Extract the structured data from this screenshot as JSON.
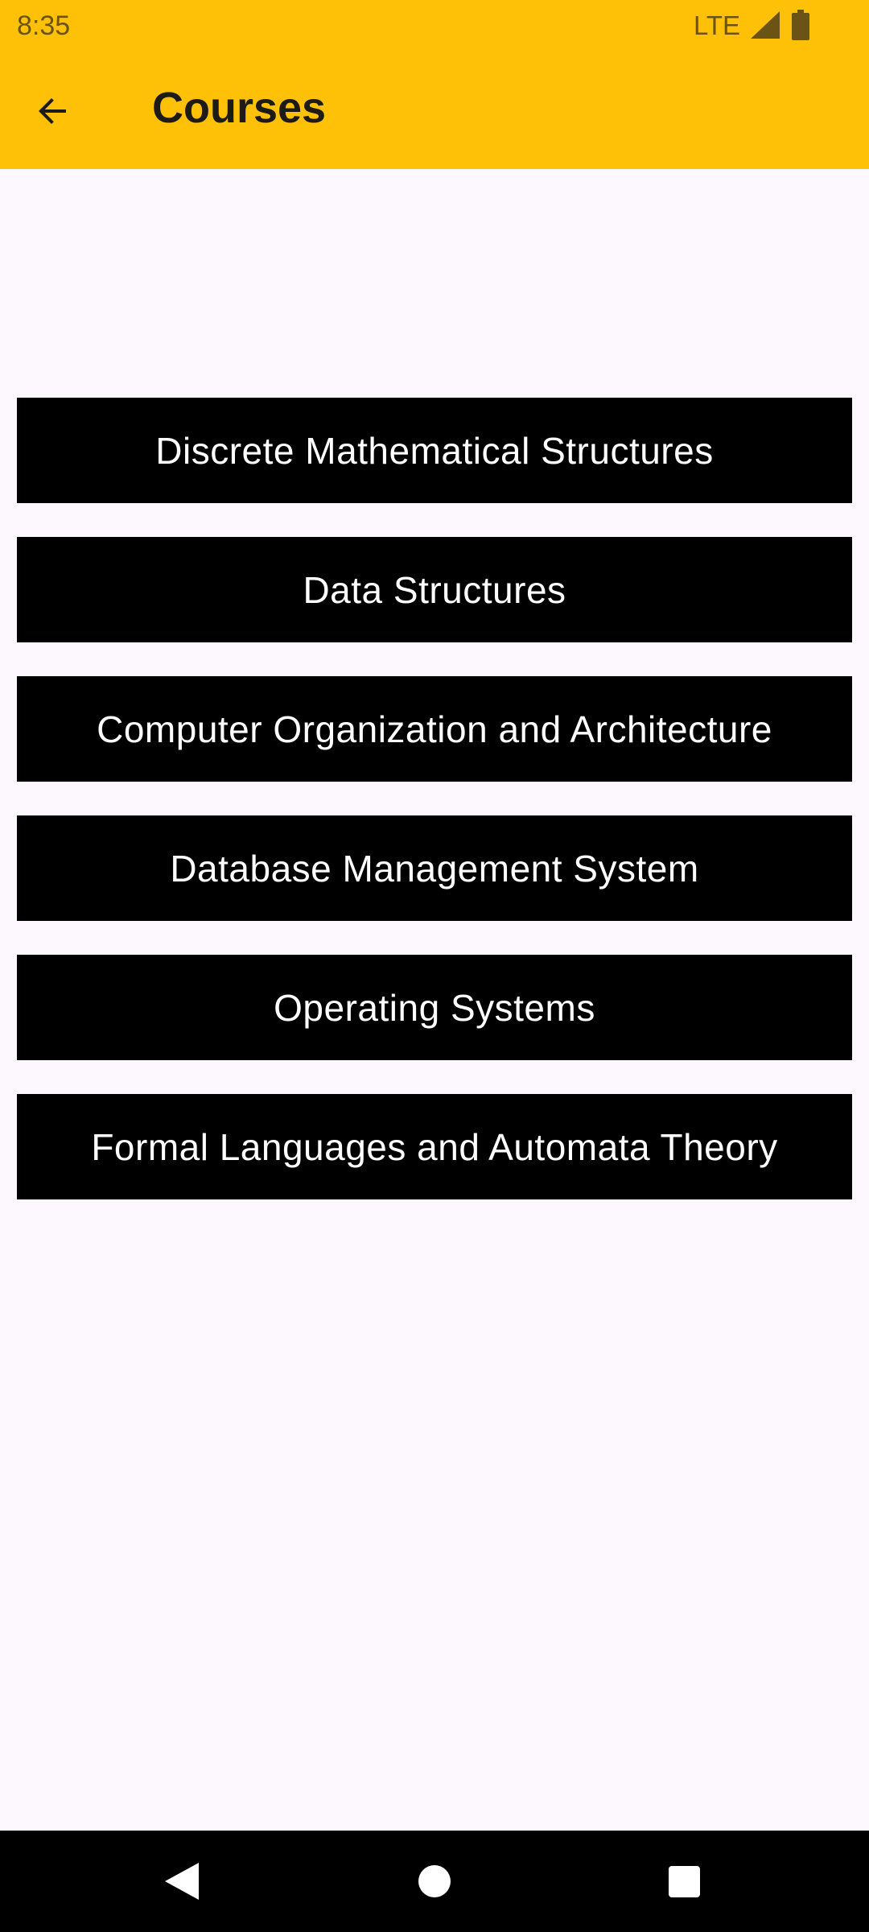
{
  "status_bar": {
    "time": "8:35",
    "network": "LTE",
    "icons": [
      "signal-icon",
      "battery-icon"
    ]
  },
  "app_bar": {
    "back_icon": "arrow-left-icon",
    "title": "Courses",
    "background": "#FFC107"
  },
  "courses": [
    "Discrete Mathematical Structures",
    "Data Structures",
    "Computer Organization and Architecture",
    "Database Management System",
    "Operating Systems",
    "Formal Languages and Automata Theory"
  ],
  "nav_bar": {
    "icons": [
      "nav-back-icon",
      "nav-home-icon",
      "nav-recents-icon"
    ]
  },
  "colors": {
    "accent": "#FFC107",
    "button_bg": "#000000",
    "button_text": "#FFFFFF",
    "page_bg": "#FDF8FD"
  }
}
